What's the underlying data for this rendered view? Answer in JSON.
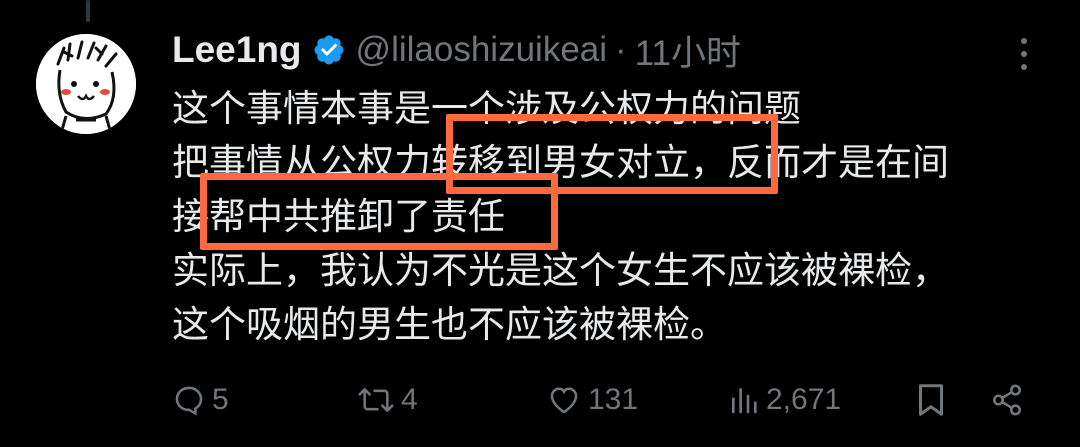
{
  "tweet": {
    "author_name": "Lee1ng",
    "handle": "@lilaoshizuikeai",
    "separator": "·",
    "time": "11小时",
    "lines": [
      "这个事情本事是一个涉及公权力的问题",
      "把事情从公权力转移到男女对立，反而才是在间",
      "接帮中共推卸了责任",
      "实际上，我认为不光是这个女生不应该被裸检，",
      "这个吸烟的男生也不应该被裸检。"
    ],
    "highlight_color": "#ff6a3d"
  },
  "actions": {
    "reply_count": "5",
    "retweet_count": "4",
    "like_count": "131",
    "views_count": "2,671"
  },
  "icons": [
    "reply-icon",
    "retweet-icon",
    "like-icon",
    "views-icon",
    "bookmark-icon",
    "share-icon",
    "verified-badge-icon",
    "more-icon"
  ],
  "colors": {
    "background": "#000000",
    "text": "#e7e9ea",
    "muted": "#71767b",
    "verified": "#1d9bf0"
  }
}
